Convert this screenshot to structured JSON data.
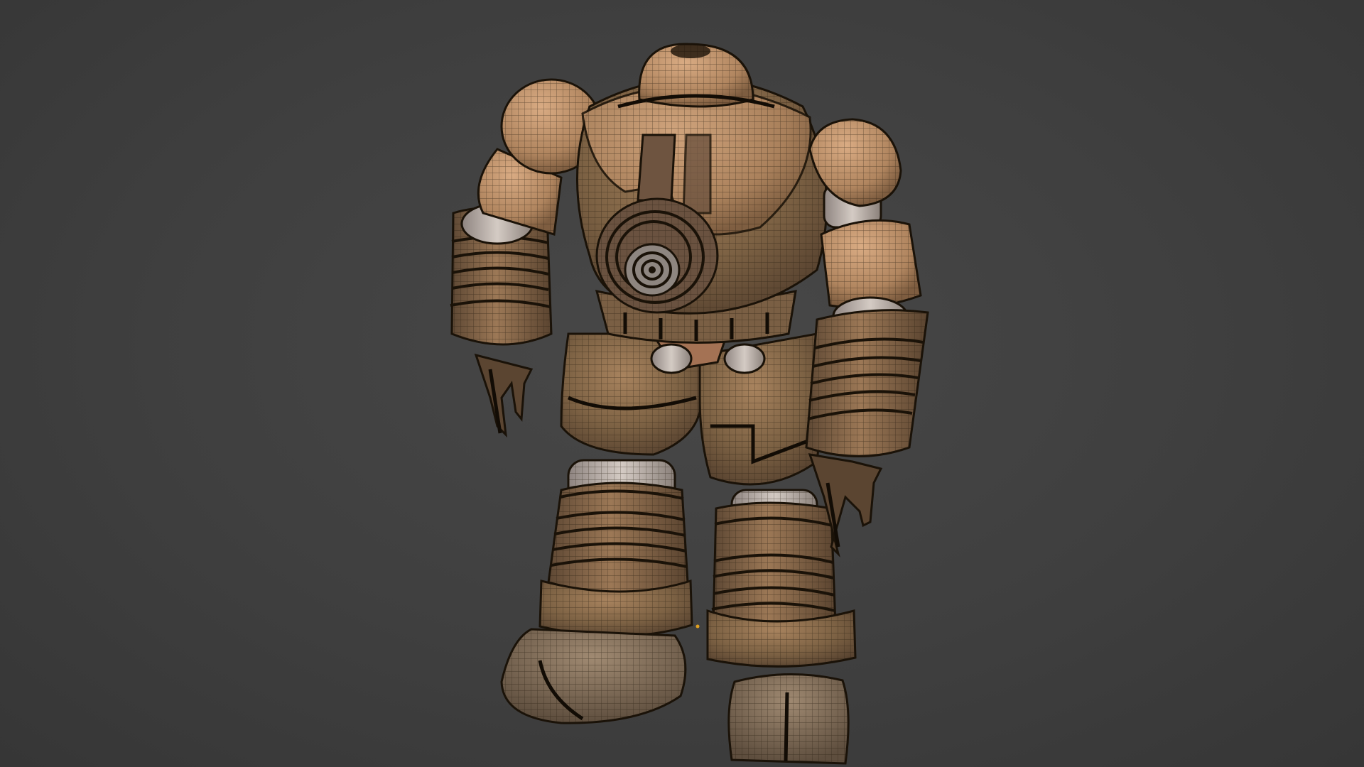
{
  "viewport": {
    "background_color": "#3f3f3f",
    "display_mode": "wireframe-over-solid",
    "object": "robot-mech-model",
    "colors": {
      "base": "#8a6c4c",
      "light": "#c99b74",
      "dark": "#5c4632",
      "joint": "#b9aea6",
      "wire": "#1a1208"
    }
  },
  "origin_marker": {
    "icon": "origin-dot-icon",
    "color": "#e0a020"
  }
}
